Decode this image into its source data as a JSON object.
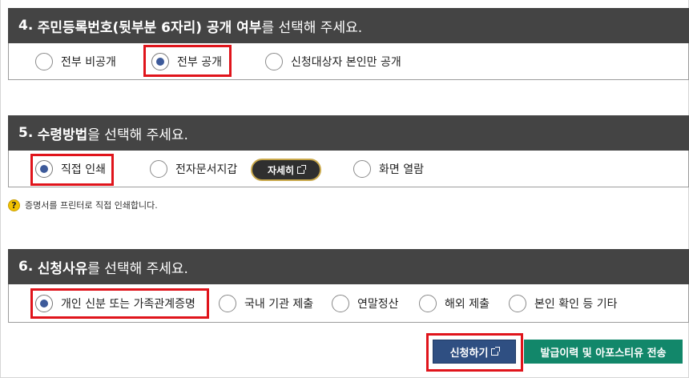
{
  "section4": {
    "number": "4.",
    "title_strong": "주민등록번호(뒷부분 6자리) 공개 여부",
    "title_rest": "를 선택해 주세요.",
    "options": [
      {
        "label": "전부 비공개",
        "checked": false
      },
      {
        "label": "전부 공개",
        "checked": true
      },
      {
        "label": "신청대상자 본인만 공개",
        "checked": false
      }
    ]
  },
  "section5": {
    "number": "5.",
    "title_strong": "수령방법",
    "title_rest": "을 선택해 주세요.",
    "options": [
      {
        "label": "직접 인쇄",
        "checked": true
      },
      {
        "label": "전자문서지갑",
        "checked": false
      },
      {
        "label": "화면 열람",
        "checked": false
      }
    ],
    "detail_button": "자세히",
    "help_icon": "question-icon",
    "help_text": "증명서를 프린터로 직접 인쇄합니다."
  },
  "section6": {
    "number": "6.",
    "title_strong": "신청사유",
    "title_rest": "를 선택해 주세요.",
    "options": [
      {
        "label": "개인 신분 또는 가족관계증명",
        "checked": true
      },
      {
        "label": "국내 기관 제출",
        "checked": false
      },
      {
        "label": "연말정산",
        "checked": false
      },
      {
        "label": "해외 제출",
        "checked": false
      },
      {
        "label": "본인 확인 등 기타",
        "checked": false
      }
    ]
  },
  "actions": {
    "apply_label": "신청하기",
    "history_label": "발급이력 및 아포스티유 전송"
  },
  "colors": {
    "header_bg": "#444444",
    "radio_dot": "#3d5a9a",
    "highlight_box": "#e0141b",
    "apply_bg": "#2f4f82",
    "history_bg": "#12876a",
    "detail_border": "#c9a84a"
  }
}
